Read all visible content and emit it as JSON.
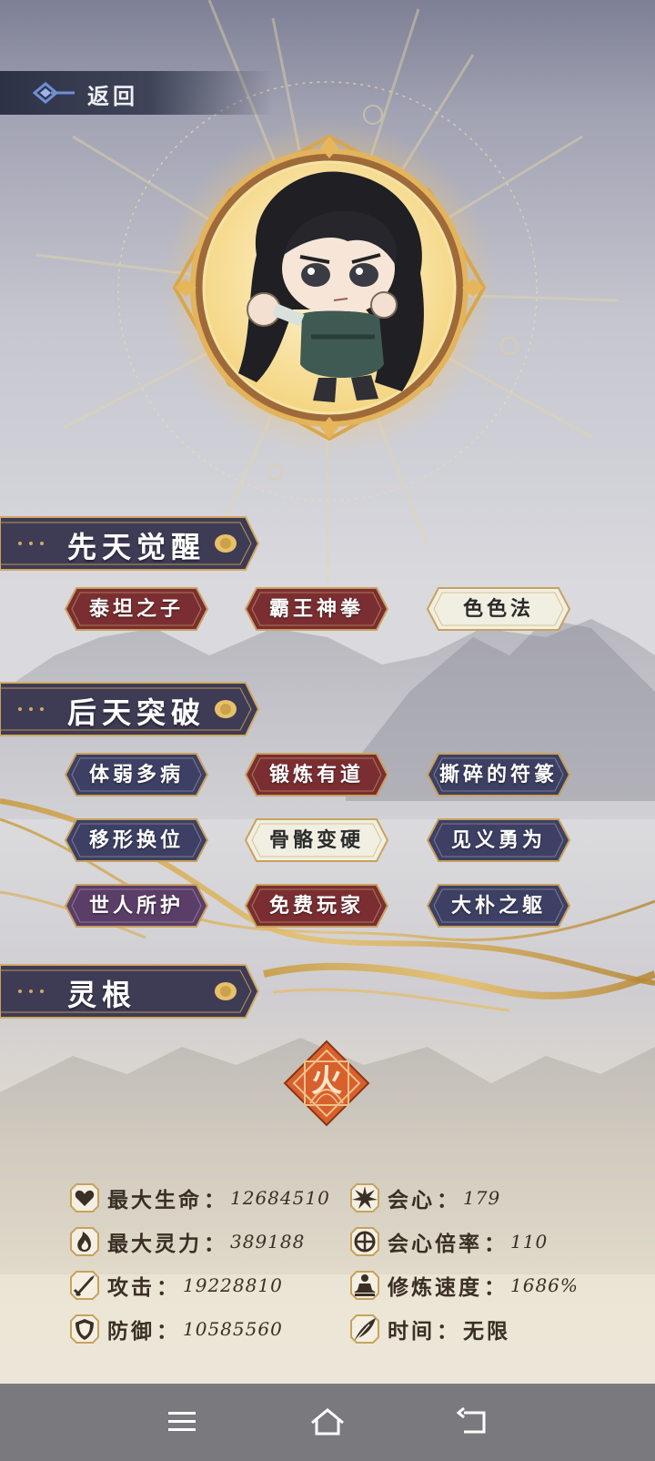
{
  "header": {
    "back_label": "返回"
  },
  "sections": {
    "innate": {
      "title": "先天觉醒",
      "tags": [
        {
          "label": "泰坦之子",
          "style": "red"
        },
        {
          "label": "霸王神拳",
          "style": "red"
        },
        {
          "label": "色色法",
          "style": "light"
        }
      ]
    },
    "acquired": {
      "title": "后天突破",
      "tags": [
        {
          "label": "体弱多病",
          "style": "blue"
        },
        {
          "label": "锻炼有道",
          "style": "red"
        },
        {
          "label": "撕碎的符篆",
          "style": "blue"
        },
        {
          "label": "移形换位",
          "style": "blue"
        },
        {
          "label": "骨骼变硬",
          "style": "light"
        },
        {
          "label": "见义勇为",
          "style": "blue"
        },
        {
          "label": "世人所护",
          "style": "purple"
        },
        {
          "label": "免费玩家",
          "style": "red"
        },
        {
          "label": "大朴之躯",
          "style": "blue"
        }
      ]
    },
    "spirit_root": {
      "title": "灵根",
      "element": "火"
    }
  },
  "stats": {
    "max_hp": {
      "label": "最大生命",
      "value": "12684510",
      "icon": "heart-icon"
    },
    "crit": {
      "label": "会心",
      "value": "179",
      "icon": "burst-icon"
    },
    "max_spirit": {
      "label": "最大灵力",
      "value": "389188",
      "icon": "flame-icon"
    },
    "crit_multiplier": {
      "label": "会心倍率",
      "value": "110",
      "icon": "target-icon"
    },
    "attack": {
      "label": "攻击",
      "value": "19228810",
      "icon": "sword-icon"
    },
    "cultivation_speed": {
      "label": "修炼速度",
      "value": "1686%",
      "icon": "meditation-icon"
    },
    "defense": {
      "label": "防御",
      "value": "10585560",
      "icon": "shield-icon"
    },
    "time": {
      "label": "时间",
      "value": "无限",
      "icon": "feather-icon"
    }
  },
  "colors": {
    "tag_red": "#7b2e32",
    "tag_blue": "#3d4064",
    "tag_purple": "#5a3e68",
    "tag_light": "#f1efe2",
    "banner": "#3c3a52",
    "gold": "#d9a64a",
    "fire": "#d8602c"
  },
  "nav": {
    "menu_icon": "menu-icon",
    "home_icon": "home-icon",
    "back_icon": "back-arrow-icon"
  }
}
